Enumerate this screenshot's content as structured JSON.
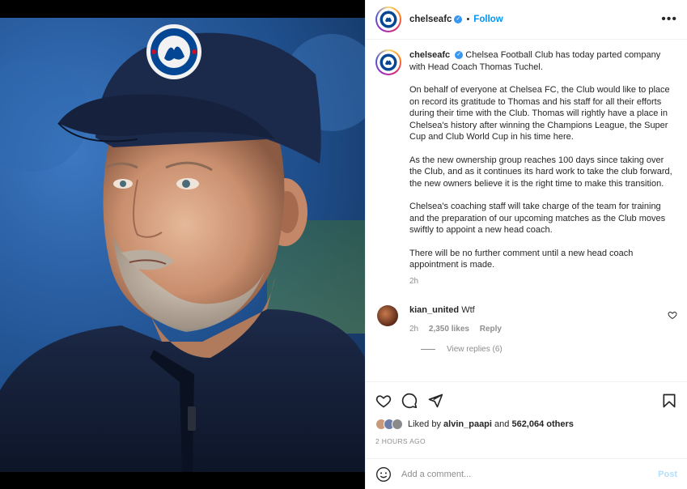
{
  "post": {
    "username": "chelseafc",
    "follow_label": "Follow",
    "dot": "•",
    "more_label": "•••"
  },
  "caption": {
    "username": "chelseafc",
    "intro": "Chelsea Football Club has today parted company with Head Coach Thomas Tuchel.",
    "paragraphs": [
      "On behalf of everyone at Chelsea FC, the Club would like to place on record its gratitude to Thomas and his staff for all their efforts during their time with the Club. Thomas will rightly have a place in Chelsea's history after winning the Champions League, the Super Cup and Club World Cup in his time here.",
      "As the new ownership group reaches 100 days since taking over the Club, and as it continues its hard work to take the club forward, the new owners believe it is the right time to make this transition.",
      "Chelsea's coaching staff will take charge of the team for training and the preparation of our upcoming matches as the Club moves swiftly to appoint a new head coach.",
      "There will be no further comment until a new head coach appointment is made."
    ],
    "time": "2h"
  },
  "comment": {
    "username": "kian_united",
    "text": "Wtf",
    "time": "2h",
    "likes": "2,350 likes",
    "reply_label": "Reply",
    "view_replies": "View replies (6)"
  },
  "likes": {
    "prefix": "Liked by",
    "user": "alvin_paapi",
    "conj": "and",
    "others": "562,064 others",
    "ago": "2 HOURS AGO"
  },
  "composer": {
    "placeholder": "Add a comment...",
    "post_label": "Post"
  },
  "colors": {
    "accent": "#0095f6",
    "chelsea_blue": "#034694",
    "cap": "#1b2a4a"
  }
}
